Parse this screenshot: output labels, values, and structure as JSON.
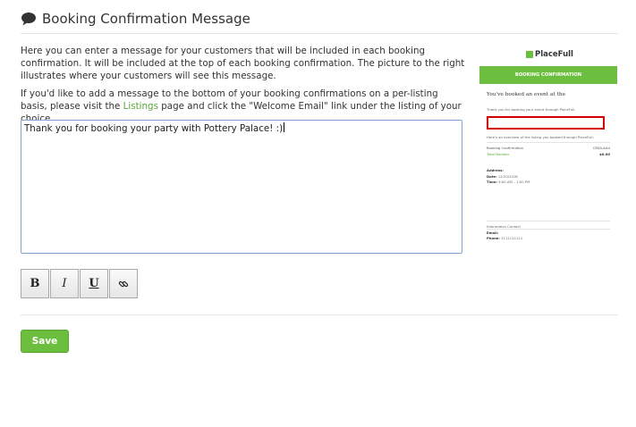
{
  "header": {
    "icon": "speech-bubble-icon",
    "title": "Booking Confirmation Message"
  },
  "intro": {
    "text": "Here you can enter a message for your customers that will be included in each booking confirmation. It will be included at the top of each booking confirmation. The picture to the right illustrates where your customers will see this message."
  },
  "listing_note": {
    "before": "If you'd like to add a message to the bottom of your booking confirmations on a per-listing basis, please visit the ",
    "link_label": "Listings",
    "after": " page and click the \"Welcome Email\" link under the listing of your choice."
  },
  "editor": {
    "value": "Thank you for booking your party with Pottery Palace! :)"
  },
  "toolbar": {
    "bold_label": "B",
    "italic_label": "I",
    "underline_label": "U",
    "link_icon": "link-icon"
  },
  "save_label": "Save",
  "preview": {
    "logo": "PlaceFull",
    "bar_title": "BOOKING CONFIRMATION",
    "heading": "You've booked an event at the",
    "thanks": "Thank you for booking your event through PlaceFull.",
    "receipt_note": "Here's an overview of the listing you booked through PlaceFull:",
    "row1_left": "Booking Confirmation",
    "row1_right": "CR9A-AA4",
    "row2_left": "Total Number",
    "row2_right": "$0.00",
    "address_label": "Address:",
    "date_label": "Date:",
    "date_value": "11/20/2018",
    "time_label": "Time:",
    "time_value": "9:00 AM – 1:00 PM",
    "contact_title": "Information Contact",
    "email_label": "Email:",
    "phone_label": "Phone:",
    "phone_value": "1111111111"
  },
  "colors": {
    "brand_green": "#6cbf3e",
    "link_green": "#5aa83a",
    "highlight_red": "#d40000",
    "editor_border": "#7fa3d3"
  }
}
